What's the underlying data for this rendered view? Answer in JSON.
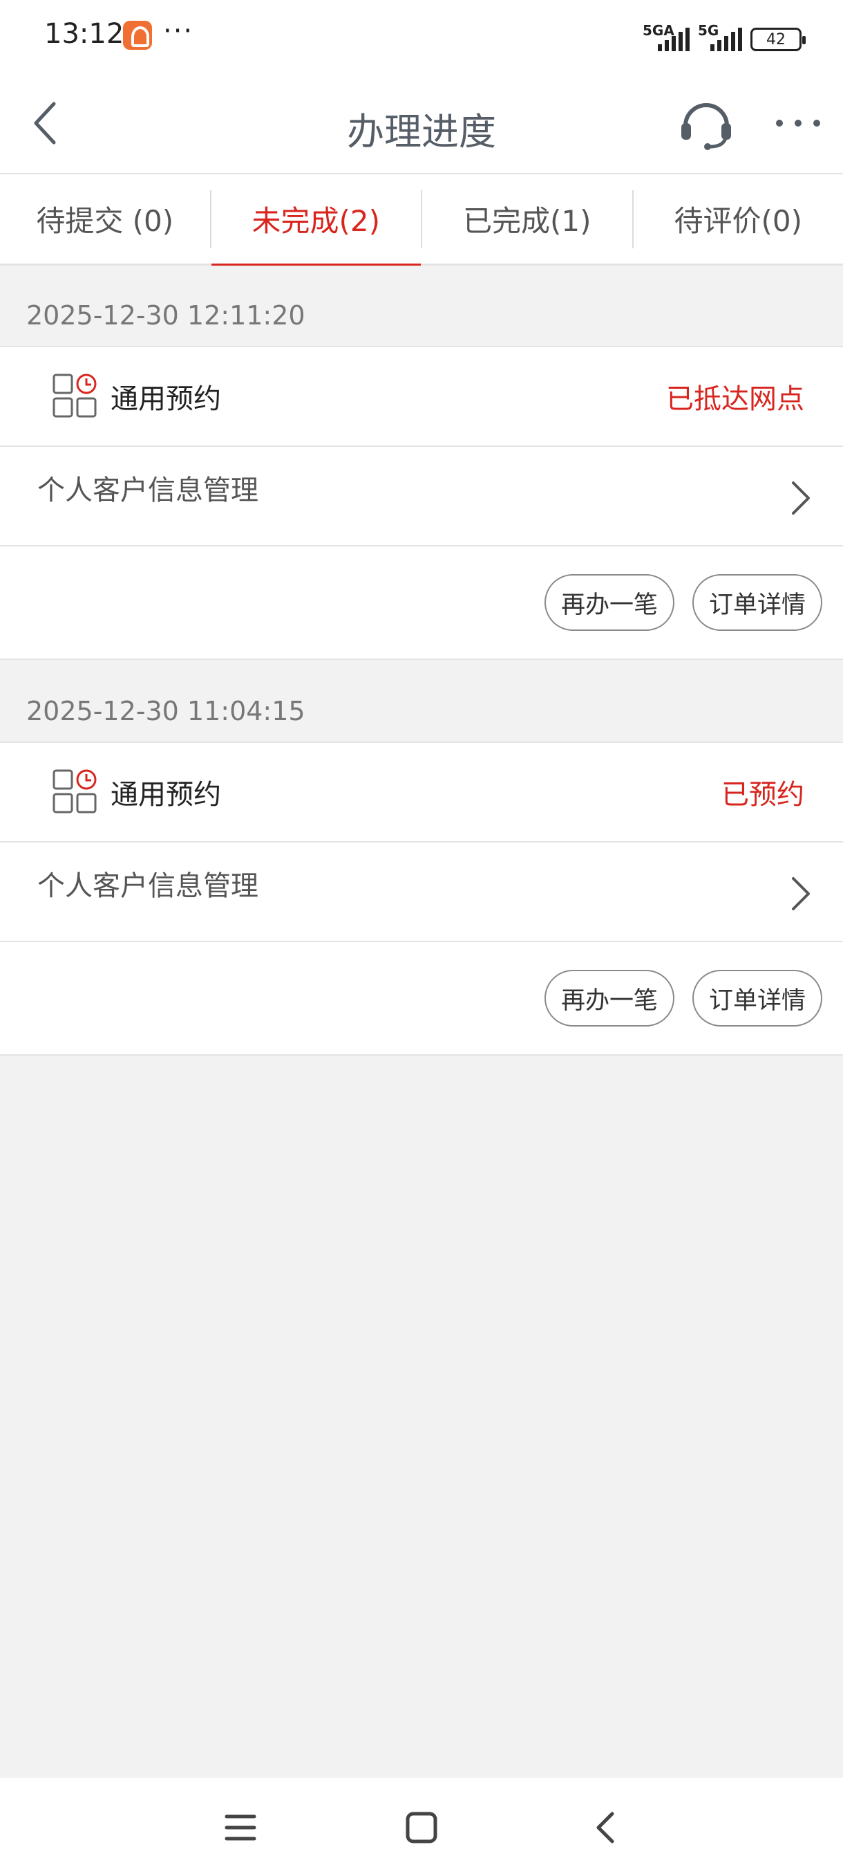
{
  "status_bar": {
    "time": "13:12",
    "dots": "···",
    "signal1_label": "5GA",
    "signal2_label": "5G",
    "battery": "42"
  },
  "header": {
    "title": "办理进度",
    "back_icon": "chevron-left-icon",
    "support_icon": "headset-icon",
    "more_icon": "more-dots-icon"
  },
  "tabs": [
    {
      "label": "待提交 (0)",
      "active": false
    },
    {
      "label": "未完成(2)",
      "active": true
    },
    {
      "label": "已完成(1)",
      "active": false
    },
    {
      "label": "待评价(0)",
      "active": false
    }
  ],
  "orders": [
    {
      "time": "2025-12-30 12:11:20",
      "service": "通用预约",
      "status": "已抵达网点",
      "business": "个人客户信息管理",
      "actions": {
        "again": "再办一笔",
        "detail": "订单详情"
      }
    },
    {
      "time": "2025-12-30 11:04:15",
      "service": "通用预约",
      "status": "已预约",
      "business": "个人客户信息管理",
      "actions": {
        "again": "再办一笔",
        "detail": "订单详情"
      }
    }
  ],
  "colors": {
    "accent": "#d8261f",
    "background": "#f2f2f2",
    "title": "#555d66"
  },
  "navbar": {
    "icons": [
      "menu-icon",
      "home-square-icon",
      "back-triangle-icon"
    ]
  }
}
